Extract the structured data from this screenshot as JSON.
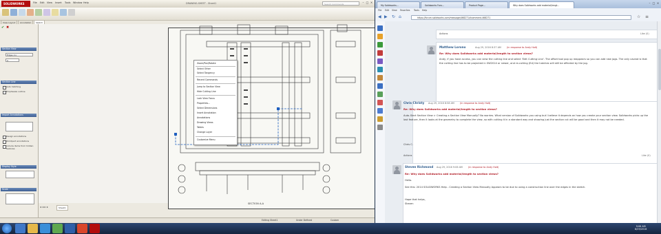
{
  "solidworks": {
    "logo": "SOLIDWORKS",
    "menus": [
      "File",
      "Edit",
      "View",
      "Insert",
      "Tools",
      "Window",
      "Help"
    ],
    "doc_title": "DRAWING-SHEET - Sheet1",
    "search_placeholder": "Search Commands",
    "tabs": [
      "View Layout",
      "Annotation",
      "Sketch"
    ],
    "panel": {
      "section1_title": "Section View",
      "section1_field": "Edge<1>",
      "section1_field2": "A",
      "section2_title": "Section Line",
      "chk_a": "Auto hatching",
      "chk_b": "Emphasize outline",
      "section3_title": "Import Annotations",
      "chk_c": "Design annotations",
      "chk_d": "DimXpert annotations",
      "chk_e": "Include items from hidden features",
      "section4_title": "Display Style",
      "section5_title": "Scale"
    },
    "context_menu": [
      "Zoom/Pan/Rotate",
      "Select Other",
      "Select Tangency",
      "Recent Commands",
      "Jump to Section View",
      "Hide Cutting Line",
      "Lock View Focus",
      "Properties...",
      "Select Dimensions",
      "Insert Annotation",
      "Annotations",
      "Drawing Views",
      "Tables",
      "Change Layer",
      "Customize Menu"
    ],
    "section_label": "SECTION A-A",
    "sheet_tab": "Sheet1",
    "status": [
      "Editing Sheet1",
      "Under Defined",
      "Custom"
    ]
  },
  "browser": {
    "tabs": [
      "My Solidworks...",
      "Solidworks Foru...",
      "Product Page...",
      "Why does Solidworks add material/lengt..."
    ],
    "menus": [
      "File",
      "Edit",
      "View",
      "Favorites",
      "Tools",
      "Help"
    ],
    "url": "https://forum.solidworks.com/message/468271#comment-468271",
    "actions_label": "Actions",
    "posts": [
      {
        "author": "Matthew Lorono",
        "meta": "Aug 29, 2016 8:37 AM",
        "reply_to": "(in response to Andy Holt)",
        "subject": "Re: Why does Solidworks add material/length to section views?",
        "body": "Andy, if you have access, you can view the cutting line and select 'Edit Cutting Line'. The offset tool pop up reappears so you can add new jogs. The only caveat is that the cutting line has to be projected in SW2014 or newer, and re-cutting (Ed) the hatches will still be affected by the jog.",
        "likes": "Like (0)"
      },
      {
        "author": "Chris Christy",
        "meta": "Aug 29, 2016 8:58 AM",
        "reply_to": "(in response to Andy Holt)",
        "subject": "Re: Why does Solidworks add material/length to section views?",
        "body": "Auto-Start Section View > Creating a Section View Manually? No worries. What version of Solidworks you using but I believe it depends on how you create your section view. Solidworks picks up the last feature, then it looks at the geometry to complete the view, so with cutting it in a standard way and showing just the section cut will be good and then it may not be needed.",
        "sign": "Chris C.",
        "likes": "Like (0)"
      },
      {
        "author": "Steven Richmond",
        "meta": "Aug 29, 2016 9:06 AM",
        "reply_to": "(in response to Andy Holt)",
        "subject": "Re: Why does Solidworks add material/length to section views?",
        "body1": "Hello.",
        "body2": "See this: 2014 SOLIDWORKS Help - Creating a Section View Manually Appears to be due to using a construction line over the edges in the sketch.",
        "body3": "Hope that helps,",
        "body4": "Steven",
        "likes": "Like (0)"
      }
    ]
  },
  "taskbar": {
    "time": "9:06 AM",
    "date": "8/29/2016"
  },
  "colors": {
    "sw_red": "#b30d0d",
    "link_blue": "#2d5b8c",
    "reply_red": "#b3202a"
  }
}
